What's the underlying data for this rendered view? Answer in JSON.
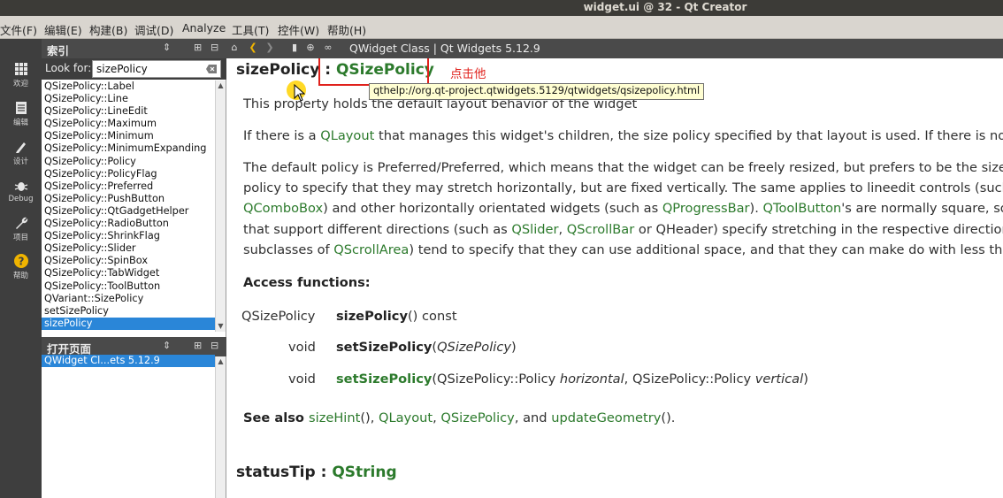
{
  "window": {
    "title": "widget.ui @ 32 - Qt Creator"
  },
  "menubar": {
    "items": [
      "文件(F)",
      "编辑(E)",
      "构建(B)",
      "调试(D)",
      "Analyze",
      "工具(T)",
      "控件(W)",
      "帮助(H)"
    ]
  },
  "modebar": {
    "modes": [
      {
        "label": "欢迎",
        "icon": "grid-icon"
      },
      {
        "label": "编辑",
        "icon": "document-icon"
      },
      {
        "label": "设计",
        "icon": "pencil-icon"
      },
      {
        "label": "Debug",
        "icon": "bug-icon"
      },
      {
        "label": "项目",
        "icon": "wrench-icon"
      },
      {
        "label": "帮助",
        "icon": "help-icon",
        "active": true
      }
    ]
  },
  "index_panel": {
    "title": "索引",
    "look_for_label": "Look for:",
    "search_value": "sizePolicy",
    "items": [
      "QSizePolicy::Label",
      "QSizePolicy::Line",
      "QSizePolicy::LineEdit",
      "QSizePolicy::Maximum",
      "QSizePolicy::Minimum",
      "QSizePolicy::MinimumExpanding",
      "QSizePolicy::Policy",
      "QSizePolicy::PolicyFlag",
      "QSizePolicy::Preferred",
      "QSizePolicy::PushButton",
      "QSizePolicy::QtGadgetHelper",
      "QSizePolicy::RadioButton",
      "QSizePolicy::ShrinkFlag",
      "QSizePolicy::Slider",
      "QSizePolicy::SpinBox",
      "QSizePolicy::TabWidget",
      "QSizePolicy::ToolButton",
      "QVariant::SizePolicy",
      "setSizePolicy",
      "sizePolicy"
    ],
    "selected_item": "sizePolicy"
  },
  "open_pages_panel": {
    "title": "打开页面",
    "items": [
      "QWidget Cl...ets 5.12.9"
    ]
  },
  "toolbar": {
    "doc_title": "QWidget Class | Qt Widgets 5.12.9"
  },
  "content": {
    "heading_name": "sizePolicy",
    "heading_sep": " : ",
    "heading_type": "QSizePolicy",
    "annotation": "点击他",
    "tooltip": "qthelp://org.qt-project.qtwidgets.5129/qtwidgets/qsizepolicy.html",
    "p1": "This property holds the default layout behavior of the widget",
    "p2": {
      "a": "If there is a ",
      "link": "QLayout",
      "b": " that manages this widget's children, the size policy specified by that layout is used. If there is no su"
    },
    "p3": {
      "l1a": "The default policy is Preferred/Preferred, which means that the widget can be freely resized, but prefers to be the size ",
      "l1b": "s",
      "l2": "policy to specify that they may stretch horizontally, but are fixed vertically. The same applies to lineedit controls (such",
      "l3_link1": "QComboBox",
      "l3a": ") and other horizontally orientated widgets (such as ",
      "l3_link2": "QProgressBar",
      "l3b": "). ",
      "l3_link3": "QToolButton",
      "l3c": "'s are normally square, so",
      "l4a": "that support different directions (such as ",
      "l4_link1": "QSlider",
      "l4b": ", ",
      "l4_link2": "QScrollBar",
      "l4c": " or QHeader) specify stretching in the respective direction",
      "l5a": "subclasses of ",
      "l5_link": "QScrollArea",
      "l5b": ") tend to specify that they can use additional space, and that they can make do with less than"
    },
    "access_functions_label": "Access functions:",
    "access_functions": [
      {
        "ret": "QSizePolicy",
        "name": "sizePolicy",
        "args_pre": "() const",
        "args_italic": "",
        "args_post": ""
      },
      {
        "ret": "void",
        "name": "setSizePolicy",
        "args_pre": "(",
        "args_italic": "QSizePolicy",
        "args_post": ")"
      }
    ],
    "af3": {
      "ret": "void",
      "name": "setSizePolicy",
      "a": "(QSizePolicy::Policy ",
      "i1": "horizontal",
      "b": ", QSizePolicy::Policy ",
      "i2": "vertical",
      "c": ")"
    },
    "see_also": {
      "label": "See also ",
      "l1": "sizeHint",
      "t1": "(), ",
      "l2": "QLayout",
      "t2": ", ",
      "l3": "QSizePolicy",
      "t3": ", and ",
      "l4": "updateGeometry",
      "t4": "()."
    },
    "next_heading_name": "statusTip",
    "next_heading_type": "QString"
  },
  "colors": {
    "link": "#2c7a2c",
    "selection": "#2a86d8",
    "annotation_red": "#e0211c"
  }
}
